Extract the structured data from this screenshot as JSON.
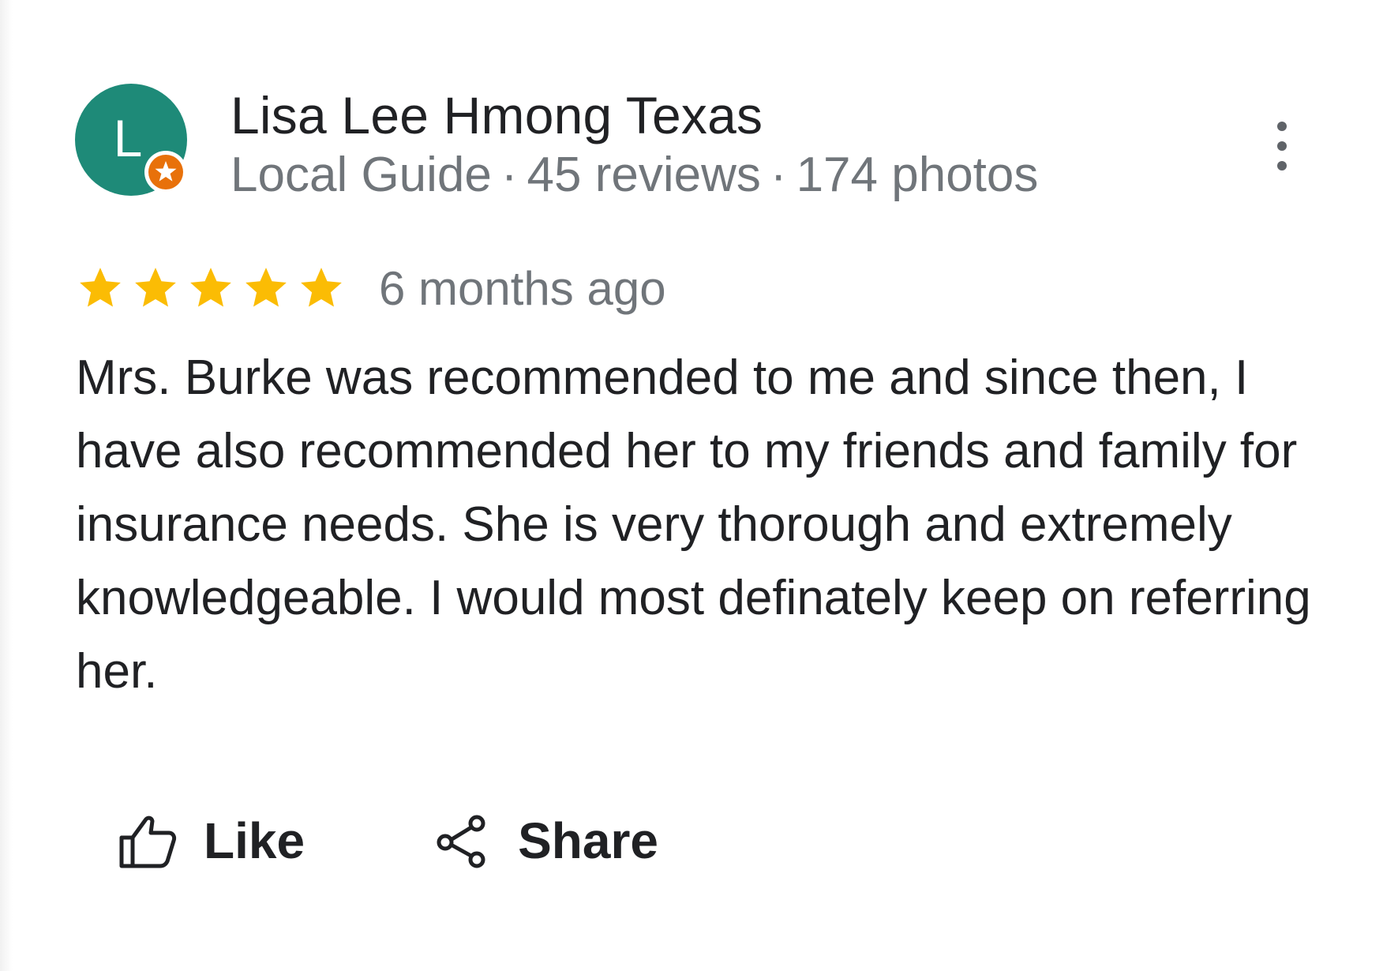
{
  "reviewer": {
    "initial": "L",
    "name": "Lisa Lee Hmong Texas",
    "guide_label": "Local Guide",
    "reviews_count": "45 reviews",
    "photos_count": "174 photos",
    "separator": "·"
  },
  "review": {
    "rating": 5,
    "rating_max": 5,
    "date": "6 months ago",
    "text": "Mrs. Burke was recommended to me and since then, I have also recommended her to my friends and family for insurance needs. She is very thorough and extremely knowledgeable. I would most definately keep on referring her."
  },
  "actions": {
    "like_label": "Like",
    "share_label": "Share"
  },
  "icons": {
    "more": "more-vert-icon",
    "star": "star-icon",
    "like": "thumb-up-icon",
    "share": "share-icon",
    "badge": "local-guide-badge-icon"
  },
  "colors": {
    "avatar": "#1e8a78",
    "badge": "#e8710a",
    "star": "#fbbc04",
    "text_primary": "#202124",
    "text_secondary": "#70757a"
  }
}
